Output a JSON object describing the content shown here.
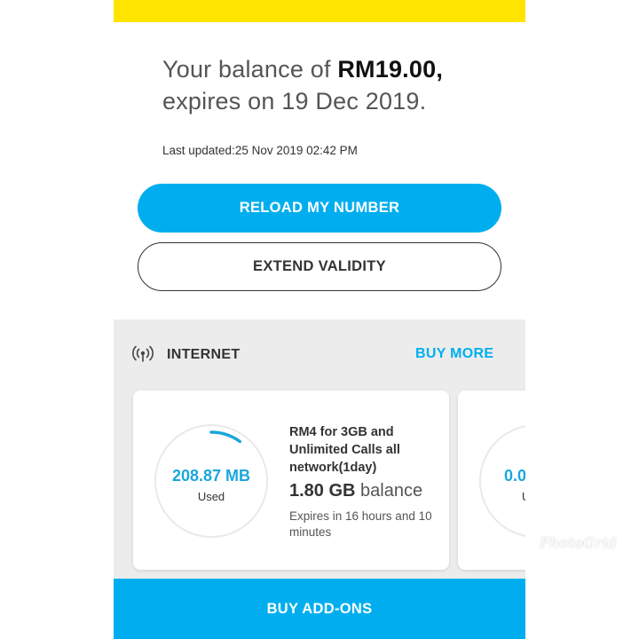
{
  "balance": {
    "prefix": "Your balance of ",
    "amount": "RM19.00,",
    "expiry_line": "expires on 19 Dec 2019."
  },
  "last_updated": "Last updated:25 Nov 2019 02:42 PM",
  "buttons": {
    "reload": "RELOAD MY NUMBER",
    "extend": "EXTEND VALIDITY",
    "addons": "BUY ADD-ONS"
  },
  "internet": {
    "title": "INTERNET",
    "buy_more": "BUY MORE",
    "icon": "signal-broadcast-icon",
    "cards": [
      {
        "used_amount": "208.87 MB",
        "used_label": "Used",
        "usage_fraction": 0.1,
        "plan_name": "RM4 for 3GB and Unlimited Calls all network(1day)",
        "balance_value": "1.80 GB",
        "balance_word": "balance",
        "expires": "Expires in 16 hours and 10 minutes"
      },
      {
        "used_amount": "0.0",
        "used_label": "U"
      }
    ]
  },
  "watermark": "PhotoGrid",
  "colors": {
    "brand_yellow": "#ffe400",
    "accent_blue": "#00aeef",
    "ring_blue": "#1aa7dc",
    "section_gray": "#ececec"
  }
}
